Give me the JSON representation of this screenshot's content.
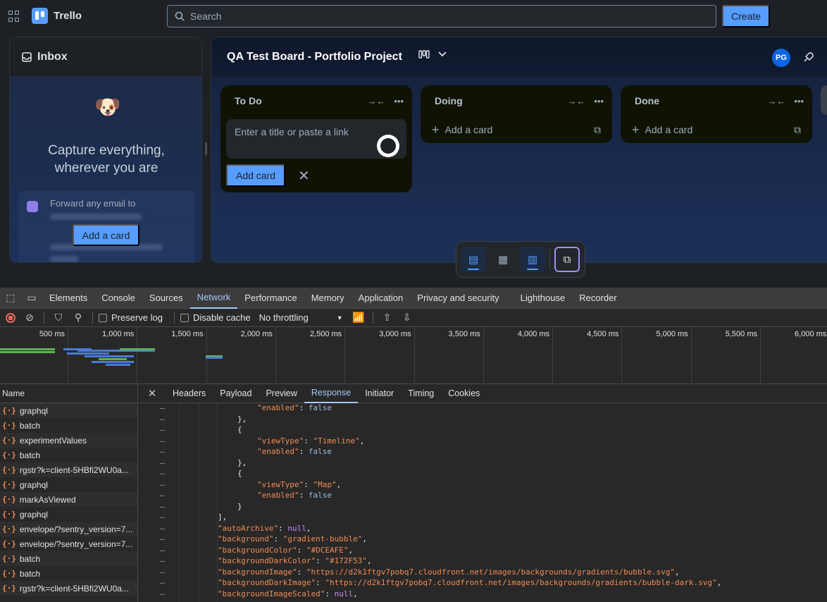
{
  "topbar": {
    "app_name": "Trello",
    "search_placeholder": "Search",
    "create_label": "Create"
  },
  "inbox": {
    "title": "Inbox",
    "capture_line1": "Capture everything,",
    "capture_line2": "wherever you are",
    "forward_text": "Forward any email to",
    "add_card_label": "Add a card"
  },
  "board": {
    "title": "QA Test Board - Portfolio Project",
    "avatar_initials": "PG",
    "lists": [
      {
        "title": "To Do",
        "composer_placeholder": "Enter a title or paste a link",
        "add_card_button": "Add card"
      },
      {
        "title": "Doing",
        "add_label": "Add a card"
      },
      {
        "title": "Done",
        "add_label": "Add a card"
      }
    ]
  },
  "devtools": {
    "tabs": [
      "Elements",
      "Console",
      "Sources",
      "Network",
      "Performance",
      "Memory",
      "Application",
      "Privacy and security",
      "Lighthouse",
      "Recorder"
    ],
    "active_tab": "Network",
    "preserve_log": "Preserve log",
    "disable_cache": "Disable cache",
    "throttling": "No throttling",
    "timeline_ticks": [
      "500 ms",
      "1,000 ms",
      "1,500 ms",
      "2,000 ms",
      "2,500 ms",
      "3,000 ms",
      "3,500 ms",
      "4,000 ms",
      "4,500 ms",
      "5,000 ms",
      "5,500 ms",
      "6,000 ms"
    ],
    "name_header": "Name",
    "requests": [
      "graphql",
      "batch",
      "experimentValues",
      "batch",
      "rgstr?k=client-5HBfi2WU0a...",
      "graphql",
      "markAsViewed",
      "graphql",
      "envelope/?sentry_version=7...",
      "envelope/?sentry_version=7...",
      "batch",
      "batch",
      "rgstr?k=client-5HBfi2WU0a..."
    ],
    "detail_tabs": [
      "Headers",
      "Payload",
      "Preview",
      "Response",
      "Initiator",
      "Timing",
      "Cookies"
    ],
    "active_detail_tab": "Response",
    "response_lines": [
      "\"enabled\": false",
      "},",
      "{",
      "\"viewType\": \"Timeline\",",
      "\"enabled\": false",
      "},",
      "{",
      "\"viewType\": \"Map\",",
      "\"enabled\": false",
      "}",
      "],",
      "\"autoArchive\": null,",
      "\"background\": \"gradient-bubble\",",
      "\"backgroundColor\": \"#DCEAFE\",",
      "\"backgroundDarkColor\": \"#172F53\",",
      "\"backgroundImage\": \"https://d2k1ftgv7pobq7.cloudfront.net/images/backgrounds/gradients/bubble.svg\",",
      "\"backgroundDarkImage\": \"https://d2k1ftgv7pobq7.cloudfront.net/images/backgrounds/gradients/bubble-dark.svg\",",
      "\"backgroundImageScaled\": null,"
    ]
  }
}
